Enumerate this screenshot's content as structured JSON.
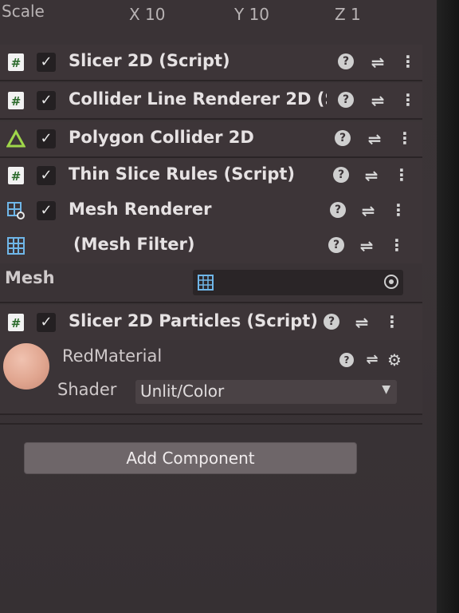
{
  "transform": {
    "scale_label": "Scale",
    "x": "X 10",
    "y": "Y 10",
    "z": "Z 1"
  },
  "components": [
    {
      "title": "Slicer 2D (Script)",
      "icon": "script-icon",
      "checked": true
    },
    {
      "title": "Collider Line Renderer 2D (S",
      "icon": "script-icon",
      "checked": true
    },
    {
      "title": "Polygon Collider 2D",
      "icon": "polygon-collider-icon",
      "checked": true
    },
    {
      "title": "Thin Slice Rules (Script)",
      "icon": "script-icon",
      "checked": true
    },
    {
      "title": "Mesh Renderer",
      "icon": "mesh-renderer-icon",
      "checked": true
    },
    {
      "title": "(Mesh Filter)",
      "icon": "mesh-filter-icon",
      "checked": false
    },
    {
      "title": "Slicer 2D Particles (Script)",
      "icon": "script-icon",
      "checked": true
    }
  ],
  "mesh": {
    "label": "Mesh",
    "value": ""
  },
  "glyphs": {
    "check": "✓",
    "help": "?",
    "sliders": "⇌",
    "more": "⋮",
    "gear": "⚙",
    "dropdown": "▼"
  },
  "material": {
    "name": "RedMaterial",
    "shader_label": "Shader",
    "shader_value": "Unlit/Color",
    "color": "#e0a58f"
  },
  "add_component_label": "Add Component"
}
